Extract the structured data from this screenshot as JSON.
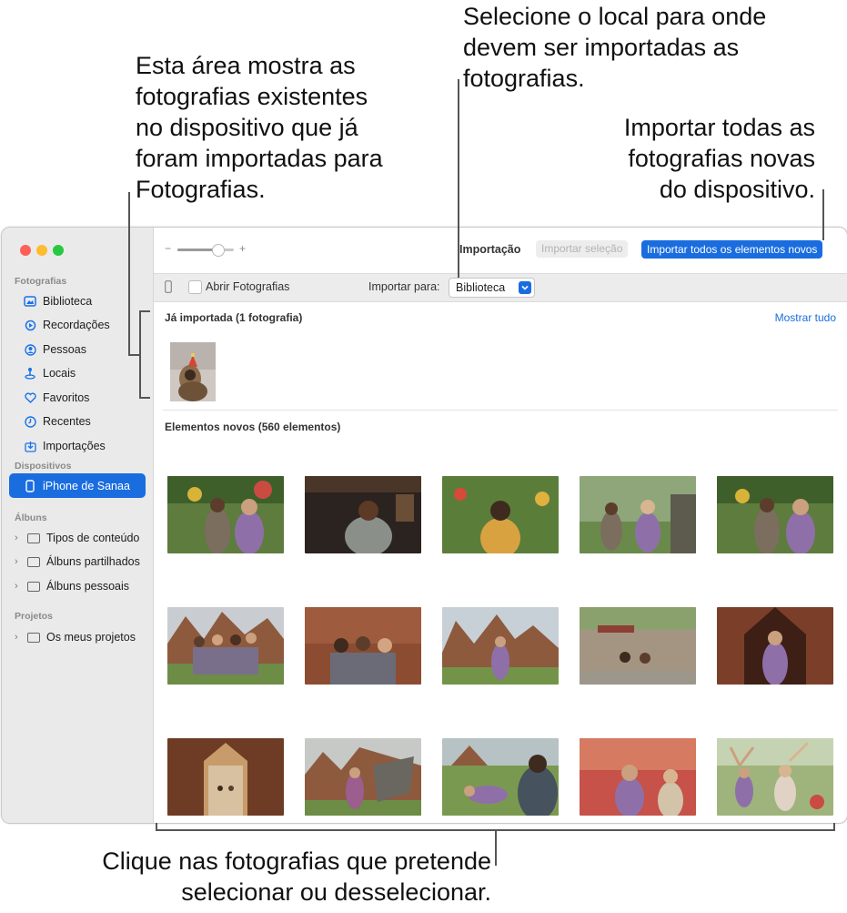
{
  "callouts": {
    "left": "Esta área mostra as\nfotografias existentes\nno dispositivo que já\nforam importadas para\nFotografias.",
    "top": "Selecione o local para onde\ndevem ser importadas as\nfotografias.",
    "right": "Importar todas as\nfotografias novas\ndo dispositivo.",
    "bottom": "Clique nas fotografias que pretende\nselecionar ou desselecionar."
  },
  "sidebar": {
    "section_photos": "Fotografias",
    "items": [
      {
        "label": "Biblioteca",
        "icon": "library-icon"
      },
      {
        "label": "Recordações",
        "icon": "memories-icon"
      },
      {
        "label": "Pessoas",
        "icon": "people-icon"
      },
      {
        "label": "Locais",
        "icon": "places-icon"
      },
      {
        "label": "Favoritos",
        "icon": "heart-icon"
      },
      {
        "label": "Recentes",
        "icon": "clock-icon"
      },
      {
        "label": "Importações",
        "icon": "import-icon"
      }
    ],
    "section_devices": "Dispositivos",
    "device": "iPhone de Sanaa",
    "section_albums": "Álbuns",
    "albums": [
      "Tipos de conteúdo",
      "Álbuns partilhados",
      "Álbuns pessoais"
    ],
    "section_projects": "Projetos",
    "projects": [
      "Os meus projetos"
    ]
  },
  "toolbar": {
    "zoom_minus": "−",
    "zoom_plus": "+",
    "title": "Importação",
    "import_selection": "Importar seleção",
    "import_all_new": "Importar todos os elementos novos"
  },
  "importbar": {
    "open_photos_label": "Abrir Fotografias",
    "import_to_label": "Importar para:",
    "import_to_value": "Biblioteca"
  },
  "content": {
    "already_imported_title": "Já importada (1 fotografia)",
    "show_all": "Mostrar tudo",
    "new_items_title": "Elementos novos (560 elementos)"
  },
  "colors": {
    "accent": "#1a6ddf",
    "close": "#fe5f57",
    "minimize": "#febc2e",
    "zoom": "#28c840"
  }
}
